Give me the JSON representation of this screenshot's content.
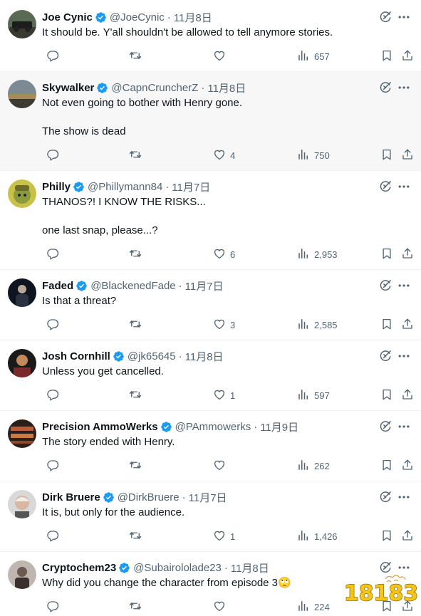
{
  "tweets": [
    {
      "name": "Joe Cynic",
      "handle": "@JoeCynic",
      "date": "11月8日",
      "text": [
        "It should be. Y'all shouldn't be allowed to tell anymore stories."
      ],
      "likes": "",
      "views": "657",
      "avatar": "avatar-joe"
    },
    {
      "name": "Skywalker",
      "handle": "@CapnCruncherZ",
      "date": "11月8日",
      "text": [
        "Not even going to bother with Henry gone.",
        "The show is dead"
      ],
      "likes": "4",
      "views": "750",
      "avatar": "avatar-sky"
    },
    {
      "name": "Philly",
      "handle": "@Phillymann84",
      "date": "11月7日",
      "text": [
        "THANOS?! I KNOW THE RISKS...",
        "one last snap, please...?"
      ],
      "likes": "6",
      "views": "2,953",
      "avatar": "avatar-philly"
    },
    {
      "name": "Faded",
      "handle": "@BlackenedFade",
      "date": "11月7日",
      "text": [
        "Is that a threat?"
      ],
      "likes": "3",
      "views": "2,585",
      "avatar": "avatar-faded"
    },
    {
      "name": "Josh Cornhill",
      "handle": "@jk65645",
      "date": "11月8日",
      "text": [
        "Unless you get cancelled."
      ],
      "likes": "1",
      "views": "597",
      "avatar": "avatar-josh"
    },
    {
      "name": "Precision AmmoWerks",
      "handle": "@PAmmowerks",
      "date": "11月9日",
      "text": [
        "The story ended with Henry."
      ],
      "likes": "",
      "views": "262",
      "avatar": "avatar-ammo"
    },
    {
      "name": "Dirk Bruere",
      "handle": "@DirkBruere",
      "date": "11月7日",
      "text": [
        "It is, but only for the audience."
      ],
      "likes": "1",
      "views": "1,426",
      "avatar": "avatar-dirk"
    },
    {
      "name": "Cryptochem23",
      "handle": "@Subairololade23",
      "date": "11月8日",
      "text": [
        "Why did you change the character from episode 3🙄"
      ],
      "likes": "",
      "views": "224",
      "avatar": "avatar-crypto"
    }
  ],
  "separator": "·",
  "watermark": "18183",
  "colors": {
    "verified": "#1d9bf0",
    "secondary": "#536471",
    "hover_bg": "#f7f7f7",
    "watermark": "#f5c518"
  },
  "icons": [
    "verified-badge-icon",
    "grok-icon",
    "more-icon",
    "reply-icon",
    "retweet-icon",
    "like-icon",
    "views-icon",
    "bookmark-icon",
    "share-icon"
  ]
}
